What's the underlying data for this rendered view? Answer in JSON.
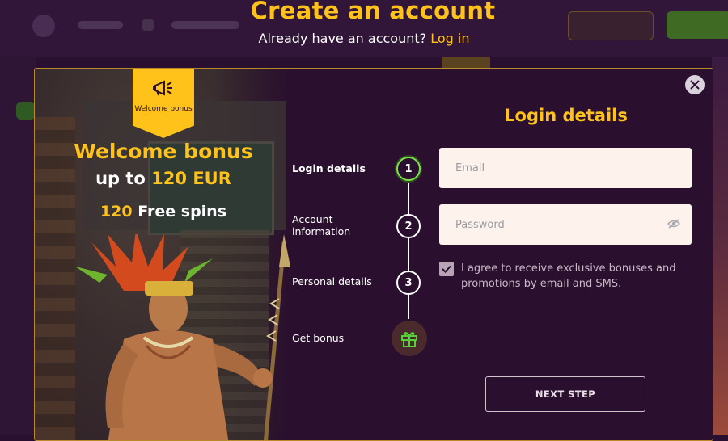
{
  "header": {
    "title": "Create an account",
    "subtitle_text": "Already have an account?",
    "login_link": "Log in"
  },
  "promo": {
    "ribbon_text": "Welcome bonus",
    "title": "Welcome bonus",
    "line2_prefix": "up to ",
    "line2_highlight": "120 EUR",
    "line3_highlight": "120",
    "line3_suffix": " Free spins"
  },
  "steps": [
    {
      "label": "Login details",
      "number": "1",
      "active": true
    },
    {
      "label": "Account information",
      "number": "2",
      "active": false
    },
    {
      "label": "Personal details",
      "number": "3",
      "active": false
    },
    {
      "label": "Get bonus",
      "icon": "gift-icon",
      "active": false
    }
  ],
  "form": {
    "title": "Login details",
    "email_placeholder": "Email",
    "password_placeholder": "Password",
    "agree_text": "I agree to receive exclusive bonuses and promotions by email and SMS.",
    "agree_checked": true,
    "next_button": "NEXT STEP"
  },
  "colors": {
    "accent": "#ffc21a",
    "background": "#2a0f2e",
    "active_step": "#7ee04a"
  }
}
